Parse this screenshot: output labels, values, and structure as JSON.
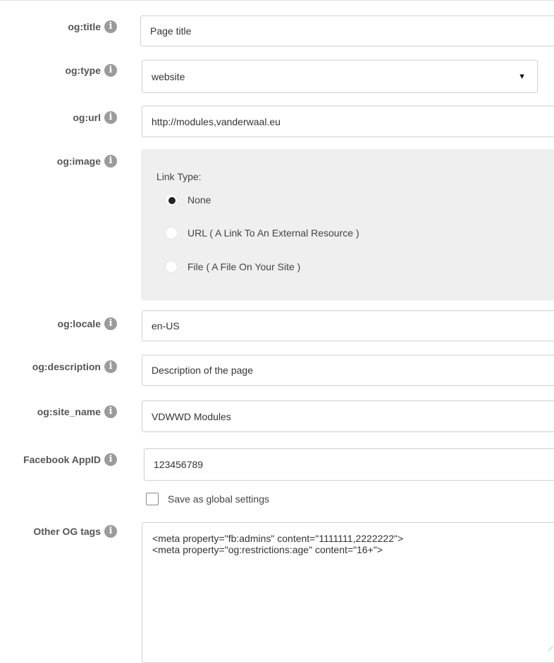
{
  "rows": {
    "title": {
      "label": "og:title",
      "value": "Page title"
    },
    "type": {
      "label": "og:type",
      "value": "website"
    },
    "url": {
      "label": "og:url",
      "value": "http://modules,vanderwaal.eu"
    },
    "image": {
      "label": "og:image",
      "link_type_label": "Link Type:",
      "options": [
        {
          "label": "None",
          "checked": true
        },
        {
          "label": "URL ( A Link To An External Resource )",
          "checked": false
        },
        {
          "label": "File ( A File On Your Site )",
          "checked": false
        }
      ]
    },
    "locale": {
      "label": "og:locale",
      "value": "en-US"
    },
    "description": {
      "label": "og:description",
      "value": "Description of the page"
    },
    "site_name": {
      "label": "og:site_name",
      "value": "VDWWD Modules"
    },
    "app_id": {
      "label": "Facebook AppID",
      "value": "123456789"
    },
    "global": {
      "label": "Save as global settings",
      "checked": false
    },
    "other": {
      "label": "Other OG tags",
      "value": "<meta property=\"fb:admins\" content=\"1111111,2222222\">\n<meta property=\"og:restrictions:age\" content=\"16+\">"
    }
  },
  "icons": {
    "info": "info-icon",
    "caret": "caret-down-icon"
  },
  "info_glyph": "i",
  "caret_glyph": "▼"
}
